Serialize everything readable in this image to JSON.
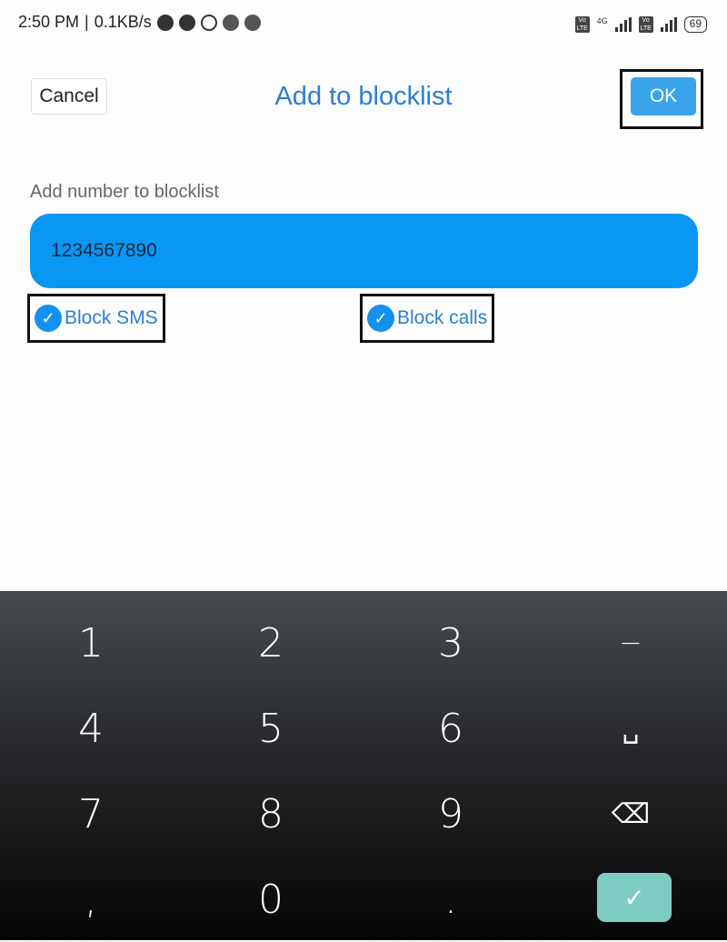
{
  "status_bar": {
    "time": "2:50 PM",
    "speed": "0.1KB/s",
    "icons": [
      "moon-icon",
      "alarm-icon",
      "whatsapp-icon",
      "snapchat-icon",
      "snapchat-icon"
    ],
    "network": "4G",
    "battery": "69"
  },
  "header": {
    "cancel": "Cancel",
    "title": "Add to blocklist",
    "ok": "OK"
  },
  "form": {
    "label": "Add number to blocklist",
    "number": "1234567890",
    "block_sms": "Block SMS",
    "block_calls": "Block calls",
    "block_sms_checked": true,
    "block_calls_checked": true
  },
  "keyboard": {
    "keys": [
      "1",
      "2",
      "3",
      "−",
      "4",
      "5",
      "6",
      "␣",
      "7",
      "8",
      "9",
      "⌫",
      ",",
      "0",
      "."
    ],
    "done": "✓"
  },
  "colors": {
    "accent": "#2a7fd0",
    "input_bg": "#0897f2",
    "ok_bg": "#3aa4eb",
    "done_bg": "#7dccc2"
  }
}
